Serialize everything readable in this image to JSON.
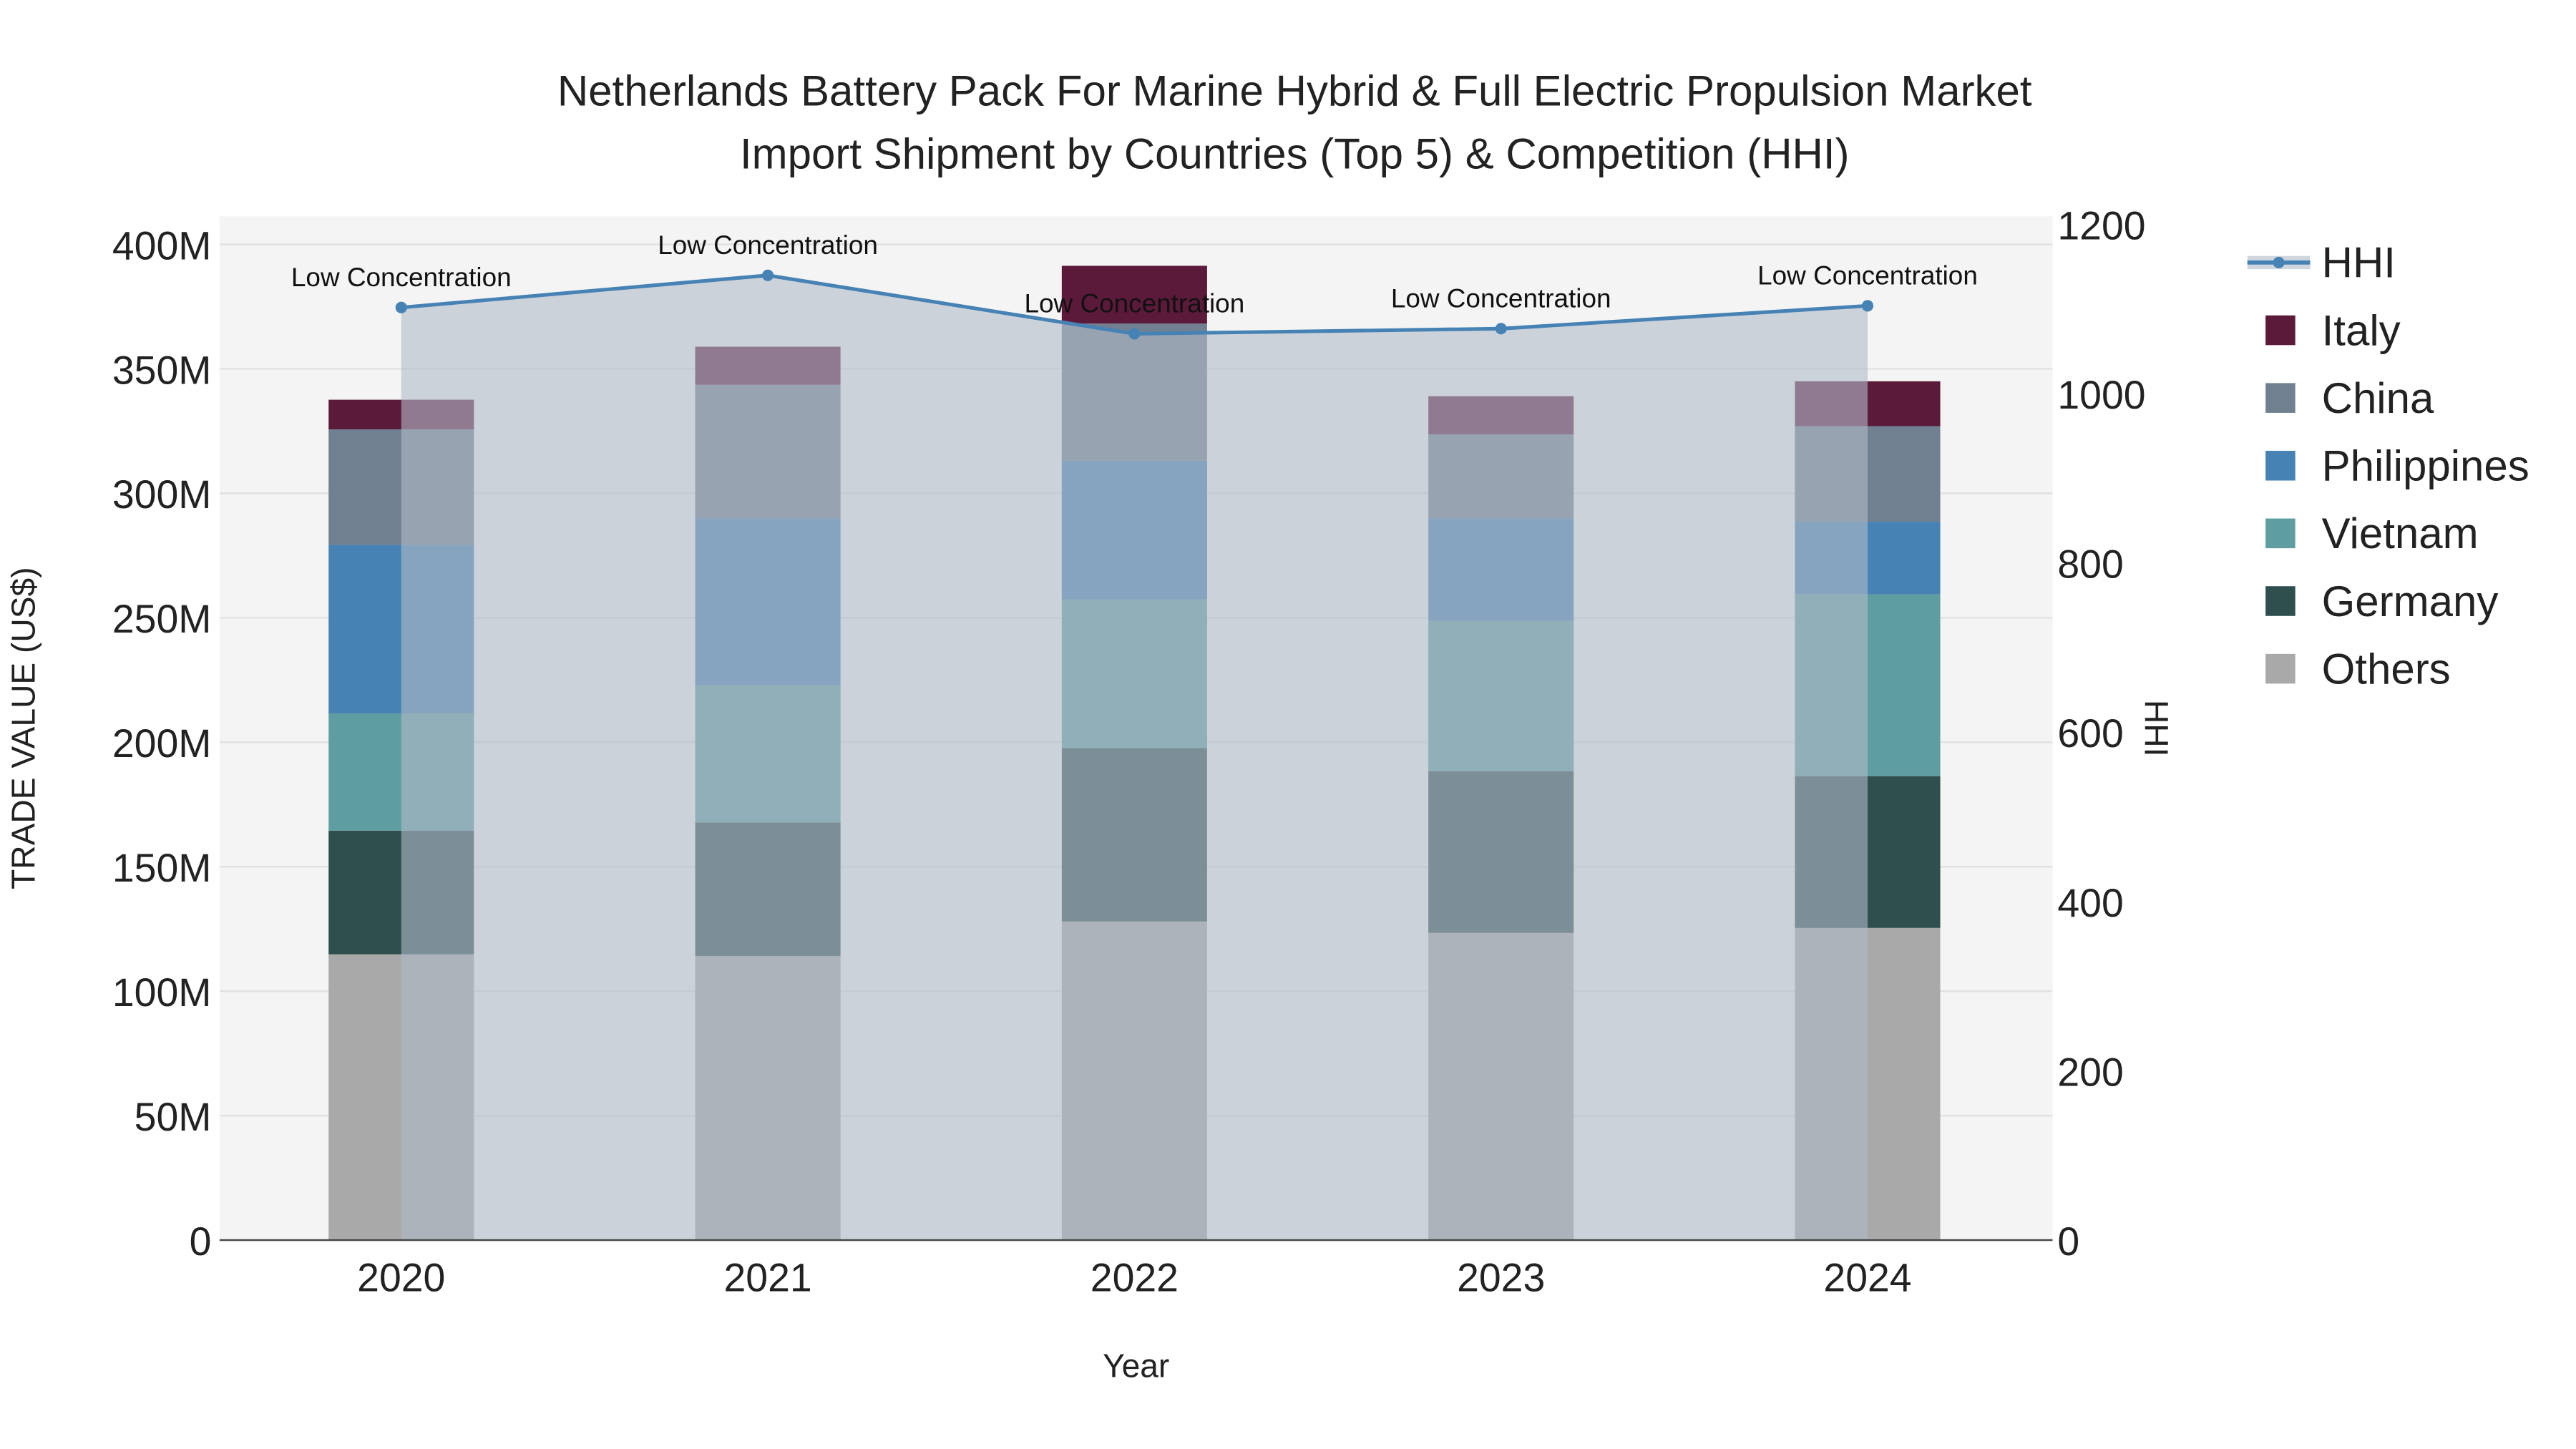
{
  "chart_data": {
    "type": "bar",
    "stacked": true,
    "title": "Netherlands Battery Pack For Marine Hybrid & Full Electric Propulsion Market",
    "subtitle": "Import Shipment by Countries (Top 5) & Competition (HHI)",
    "xlabel": "Year",
    "ylabel": "TRADE VALUE (US$)",
    "y2label": "HHI",
    "categories": [
      "2020",
      "2021",
      "2022",
      "2023",
      "2024"
    ],
    "ylim": [
      0,
      410
    ],
    "y_unit": "M",
    "yticks": [
      "0",
      "50M",
      "100M",
      "150M",
      "200M",
      "250M",
      "300M",
      "350M",
      "400M"
    ],
    "y2lim": [
      0,
      1210
    ],
    "y2ticks": [
      "0",
      "200",
      "400",
      "600",
      "800",
      "1000",
      "1200"
    ],
    "grid": true,
    "legend_position": "right",
    "series": [
      {
        "name": "Others",
        "color": "#a9a9a9",
        "values": [
          114.8,
          114.1,
          128.0,
          123.4,
          125.4
        ]
      },
      {
        "name": "Germany",
        "color": "#2f4f4f",
        "values": [
          49.7,
          53.7,
          69.7,
          65.0,
          61.0
        ]
      },
      {
        "name": "Vietnam",
        "color": "#5f9ea0",
        "values": [
          47.1,
          55.1,
          59.7,
          60.4,
          73.0
        ]
      },
      {
        "name": "Philippines",
        "color": "#4682b4",
        "values": [
          67.7,
          67.0,
          55.7,
          41.1,
          29.2
        ]
      },
      {
        "name": "China",
        "color": "#708090",
        "values": [
          46.4,
          53.7,
          55.1,
          33.8,
          38.4
        ]
      },
      {
        "name": "Italy",
        "color": "#5c1a3b",
        "values": [
          11.9,
          15.3,
          23.2,
          15.3,
          18.0
        ]
      }
    ],
    "hhi": {
      "name": "HHI",
      "color": "#4682b4",
      "values": [
        1102,
        1140,
        1071,
        1077,
        1104
      ],
      "labels": [
        "Low Concentration",
        "Low Concentration",
        "Low Concentration",
        "Low Concentration",
        "Low Concentration"
      ]
    },
    "legend_order": [
      "HHI",
      "Italy",
      "China",
      "Philippines",
      "Vietnam",
      "Germany",
      "Others"
    ]
  }
}
